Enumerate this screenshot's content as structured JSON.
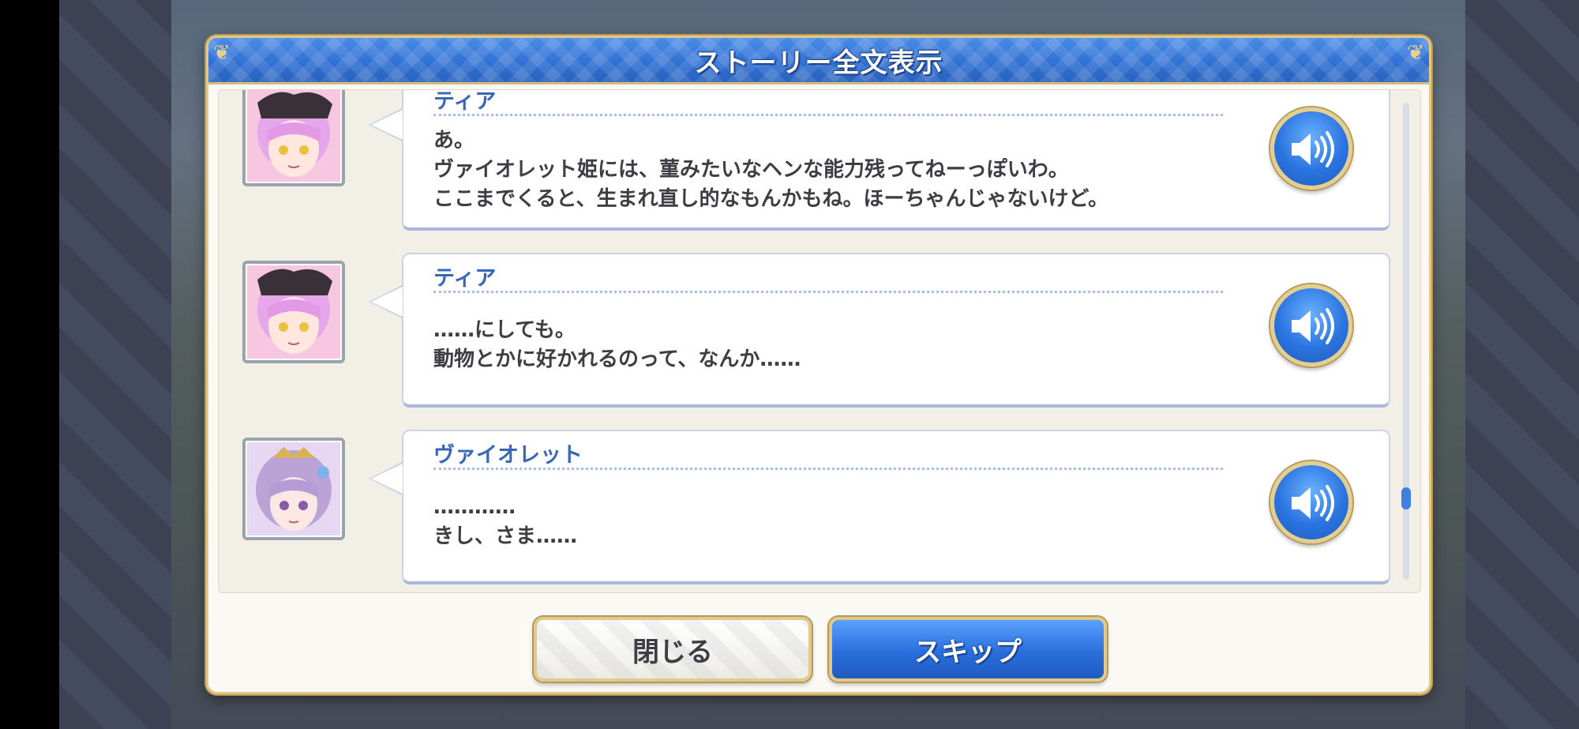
{
  "dialog": {
    "title": "ストーリー全文表示"
  },
  "entries": [
    {
      "speaker": "ティア",
      "text": "あ。\nヴァイオレット姫には、菫みたいなヘンな能力残ってねーっぽいわ。\nここまでくると、生まれ直し的なもんかもね。ほーちゃんじゃないけど。",
      "portrait_hair": "#e9a0e8",
      "icon": "speaker-icon"
    },
    {
      "speaker": "ティア",
      "text": "……にしても。\n動物とかに好かれるのって、なんか……",
      "portrait_hair": "#e9a0e8",
      "icon": "speaker-icon"
    },
    {
      "speaker": "ヴァイオレット",
      "text": "…………\nきし、さま……",
      "portrait_hair": "#b9a2d8",
      "icon": "speaker-icon"
    }
  ],
  "buttons": {
    "close_label": "閉じる",
    "skip_label": "スキップ"
  },
  "colors": {
    "accent_blue": "#2f6fd2",
    "gold_border": "#e2c98a",
    "speaker_blue": "#3768b8"
  }
}
